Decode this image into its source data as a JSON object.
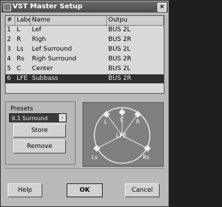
{
  "window": {
    "title": "VST Master Setup",
    "close_glyph": "×"
  },
  "table": {
    "headers": [
      "#",
      "Labe",
      "Name",
      "Outpu"
    ],
    "rows": [
      {
        "num": "1",
        "label": "L",
        "name": "Lef",
        "output": "BUS 2L"
      },
      {
        "num": "2",
        "label": "R",
        "name": "Righ",
        "output": "BUS 2R"
      },
      {
        "num": "3",
        "label": "Ls",
        "name": "Lef Surround",
        "output": "BUS 2L"
      },
      {
        "num": "4",
        "label": "Rs",
        "name": "Righ Surround",
        "output": "BUS 2R"
      },
      {
        "num": "5",
        "label": "C",
        "name": "Center",
        "output": "BUS 2L"
      },
      {
        "num": "6",
        "label": "LFE",
        "name": "Subbass",
        "output": "BUS 2R"
      }
    ],
    "selected_row": 6
  },
  "presets": {
    "label": "Presets",
    "selected": "6.1 Surround",
    "store_label": "Store",
    "remove_label": "Remove"
  },
  "speakers": {
    "front": [
      "L",
      "C",
      "R"
    ],
    "center": "LFE",
    "rear": [
      "Ls",
      "Rs"
    ]
  },
  "buttons": {
    "help": "Help",
    "ok": "OK",
    "cancel": "Cancel"
  }
}
